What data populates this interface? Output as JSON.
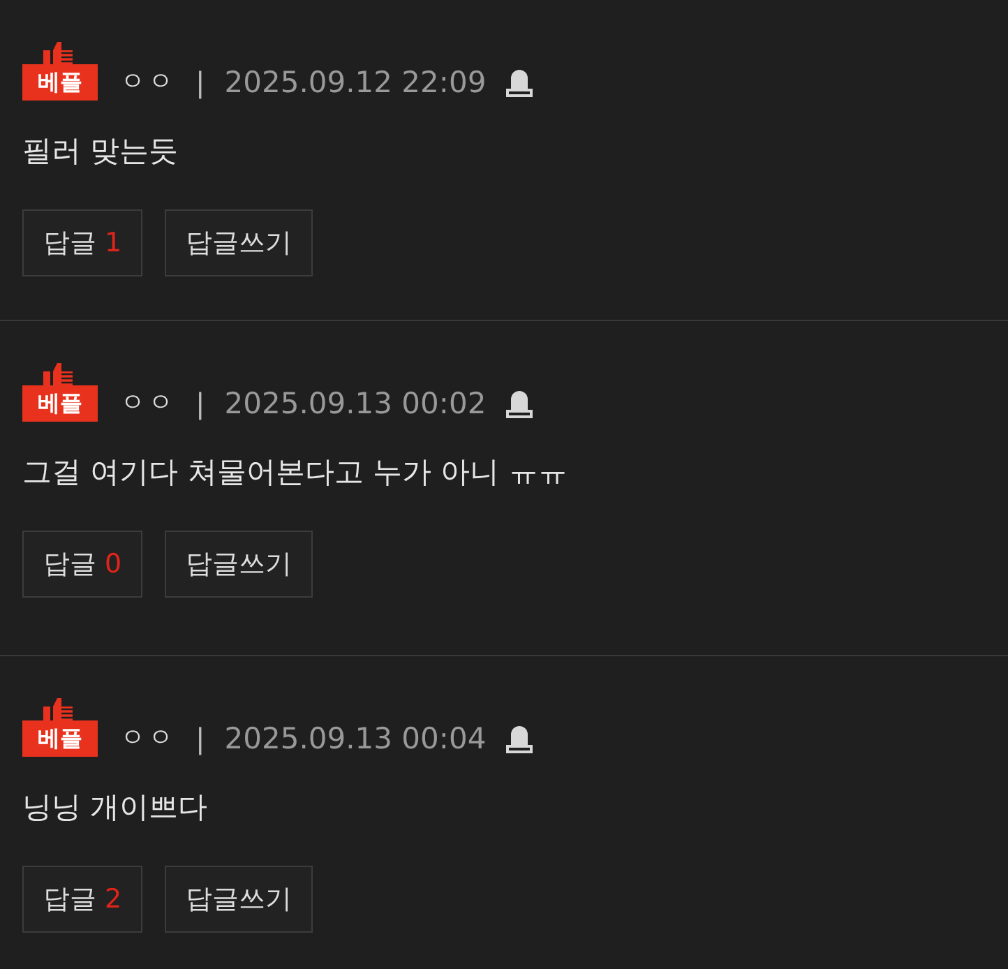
{
  "comments": [
    {
      "badge": "베플",
      "author": "ㅇㅇ",
      "separator": "|",
      "date": "2025.09.12 22:09",
      "text": "필러 맞는듯",
      "reply_label": "답글",
      "reply_count": "1",
      "write_label": "답글쓰기"
    },
    {
      "badge": "베플",
      "author": "ㅇㅇ",
      "separator": "|",
      "date": "2025.09.13 00:02",
      "text": "그걸 여기다 쳐물어본다고 누가 아니 ㅠㅠ",
      "reply_label": "답글",
      "reply_count": "0",
      "write_label": "답글쓰기"
    },
    {
      "badge": "베플",
      "author": "ㅇㅇ",
      "separator": "|",
      "date": "2025.09.13 00:04",
      "text": "닝닝 개이쁘다",
      "reply_label": "답글",
      "reply_count": "2",
      "write_label": "답글쓰기"
    }
  ]
}
